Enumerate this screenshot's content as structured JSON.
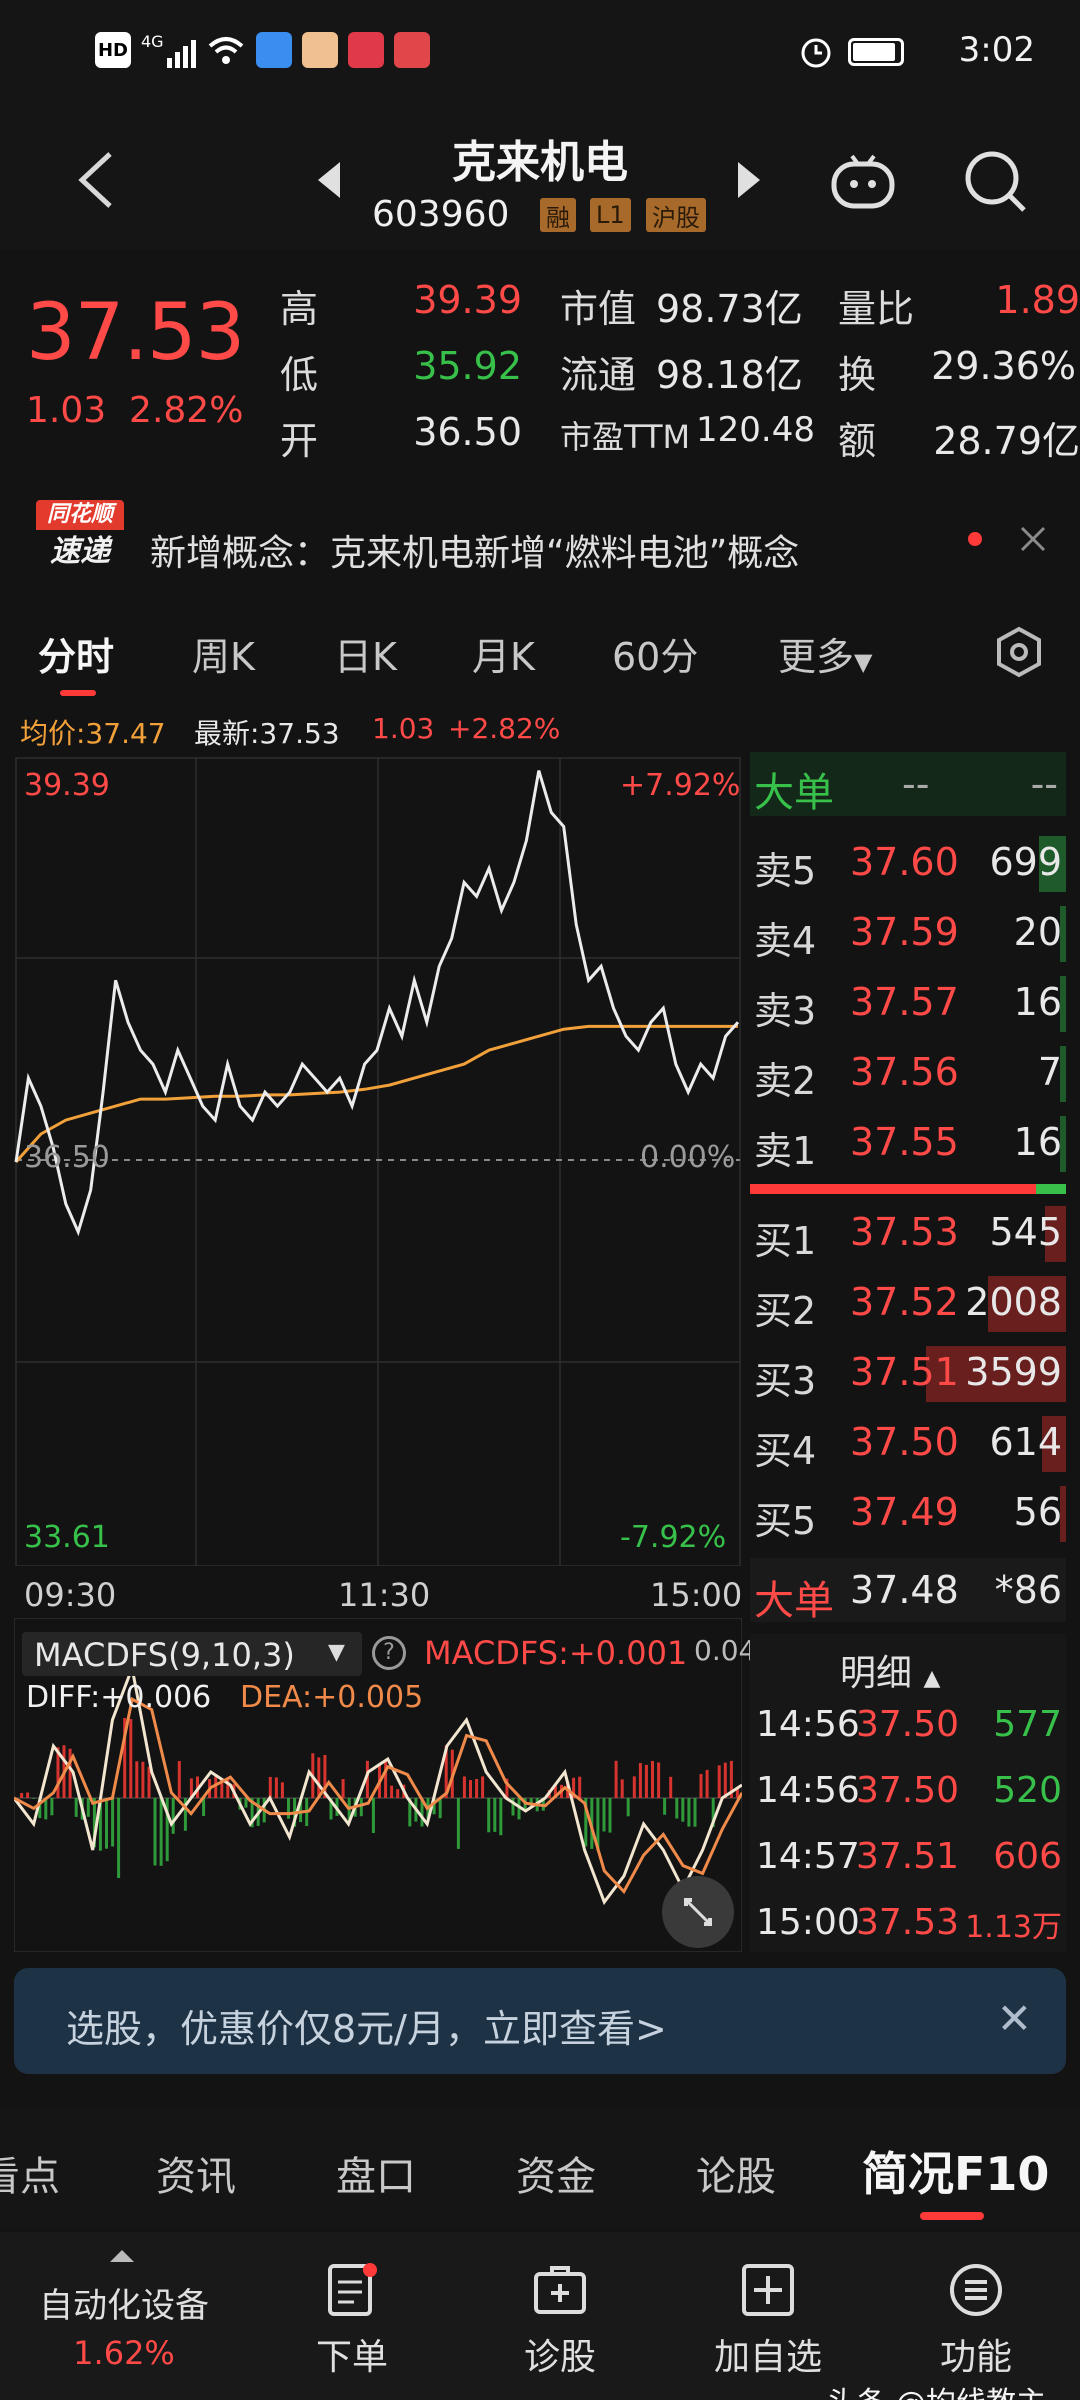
{
  "status_bar": {
    "time": "3:02",
    "network": "4G",
    "hd": "HD"
  },
  "nav": {
    "stock_name": "克来机电",
    "stock_code": "603960",
    "tags": [
      "融",
      "L1",
      "沪股"
    ]
  },
  "quote": {
    "price": "37.53",
    "change": "1.03",
    "change_pct": "2.82%",
    "high_label": "高",
    "high": "39.39",
    "low_label": "低",
    "low": "35.92",
    "open_label": "开",
    "open": "36.50",
    "mktcap_label": "市值",
    "mktcap": "98.73亿",
    "float_label": "流通",
    "float_cap": "98.18亿",
    "pe_label": "市盈TTM",
    "pe": "120.48",
    "vol_ratio_label": "量比",
    "vol_ratio": "1.89",
    "turnover_label": "换",
    "turnover": "29.36%",
    "amount_label": "额",
    "amount": "28.79亿"
  },
  "news": {
    "logo_top": "同花顺",
    "logo_bottom": "速递",
    "text": "新增概念：克来机电新增“燃料电池”概念"
  },
  "tabs": [
    "分时",
    "周K",
    "日K",
    "月K",
    "60分",
    "更多"
  ],
  "chart_head": {
    "avg": "均价:37.47",
    "latest_label": "最新:37.53",
    "chg": "1.03",
    "chg_pct": "+2.82%"
  },
  "chart_axis": {
    "top_price": "39.39",
    "top_pct": "+7.92%",
    "mid_price": "36.50",
    "mid_pct": "0.00%",
    "bot_price": "33.61",
    "bot_pct": "-7.92%",
    "times": [
      "09:30",
      "11:30",
      "15:00"
    ]
  },
  "macd": {
    "name": "MACDFS(9,10,3)",
    "macdfs": "MACDFS:+0.001",
    "right_val": "0.04",
    "diff": "DIFF:+0.006",
    "dea": "DEA:+0.005"
  },
  "book": {
    "header": "大单",
    "header_a": "--",
    "header_b": "--",
    "asks": [
      {
        "label": "卖5",
        "price": "37.60",
        "vol": "699"
      },
      {
        "label": "卖4",
        "price": "37.59",
        "vol": "20"
      },
      {
        "label": "卖3",
        "price": "37.57",
        "vol": "16"
      },
      {
        "label": "卖2",
        "price": "37.56",
        "vol": "7"
      },
      {
        "label": "卖1",
        "price": "37.55",
        "vol": "16"
      }
    ],
    "bids": [
      {
        "label": "买1",
        "price": "37.53",
        "vol": "545"
      },
      {
        "label": "买2",
        "price": "37.52",
        "vol": "2008"
      },
      {
        "label": "买3",
        "price": "37.51",
        "vol": "3599"
      },
      {
        "label": "买4",
        "price": "37.50",
        "vol": "614"
      },
      {
        "label": "买5",
        "price": "37.49",
        "vol": "56"
      }
    ],
    "big_label": "大单",
    "big_price": "37.48",
    "big_vol": "*86"
  },
  "detail": {
    "title": "明细",
    "rows": [
      {
        "time": "14:56",
        "price": "37.50",
        "vol": "577",
        "color": "#38c14a"
      },
      {
        "time": "14:56",
        "price": "37.50",
        "vol": "520",
        "color": "#38c14a"
      },
      {
        "time": "14:57",
        "price": "37.51",
        "vol": "606",
        "color": "#ff4a48"
      },
      {
        "time": "15:00",
        "price": "37.53",
        "vol": "1.13万",
        "color": "#ff4a48"
      }
    ]
  },
  "promo": {
    "text": "选股，优惠价仅8元/月，立即查看>",
    "close": "✕"
  },
  "bottom_tabs": [
    "看点",
    "资讯",
    "盘口",
    "资金",
    "论股",
    "简况F10"
  ],
  "toolbar": {
    "sector": "自动化设备",
    "sector_pct": "1.62%",
    "order": "下单",
    "diagnose": "诊股",
    "add_watch": "加自选",
    "more": "功能"
  },
  "watermark": "头条 @均线教主",
  "colors": {
    "up": "#ff4a48",
    "down": "#38c14a",
    "avg_line": "#f2a13a",
    "bg": "#131313"
  }
}
